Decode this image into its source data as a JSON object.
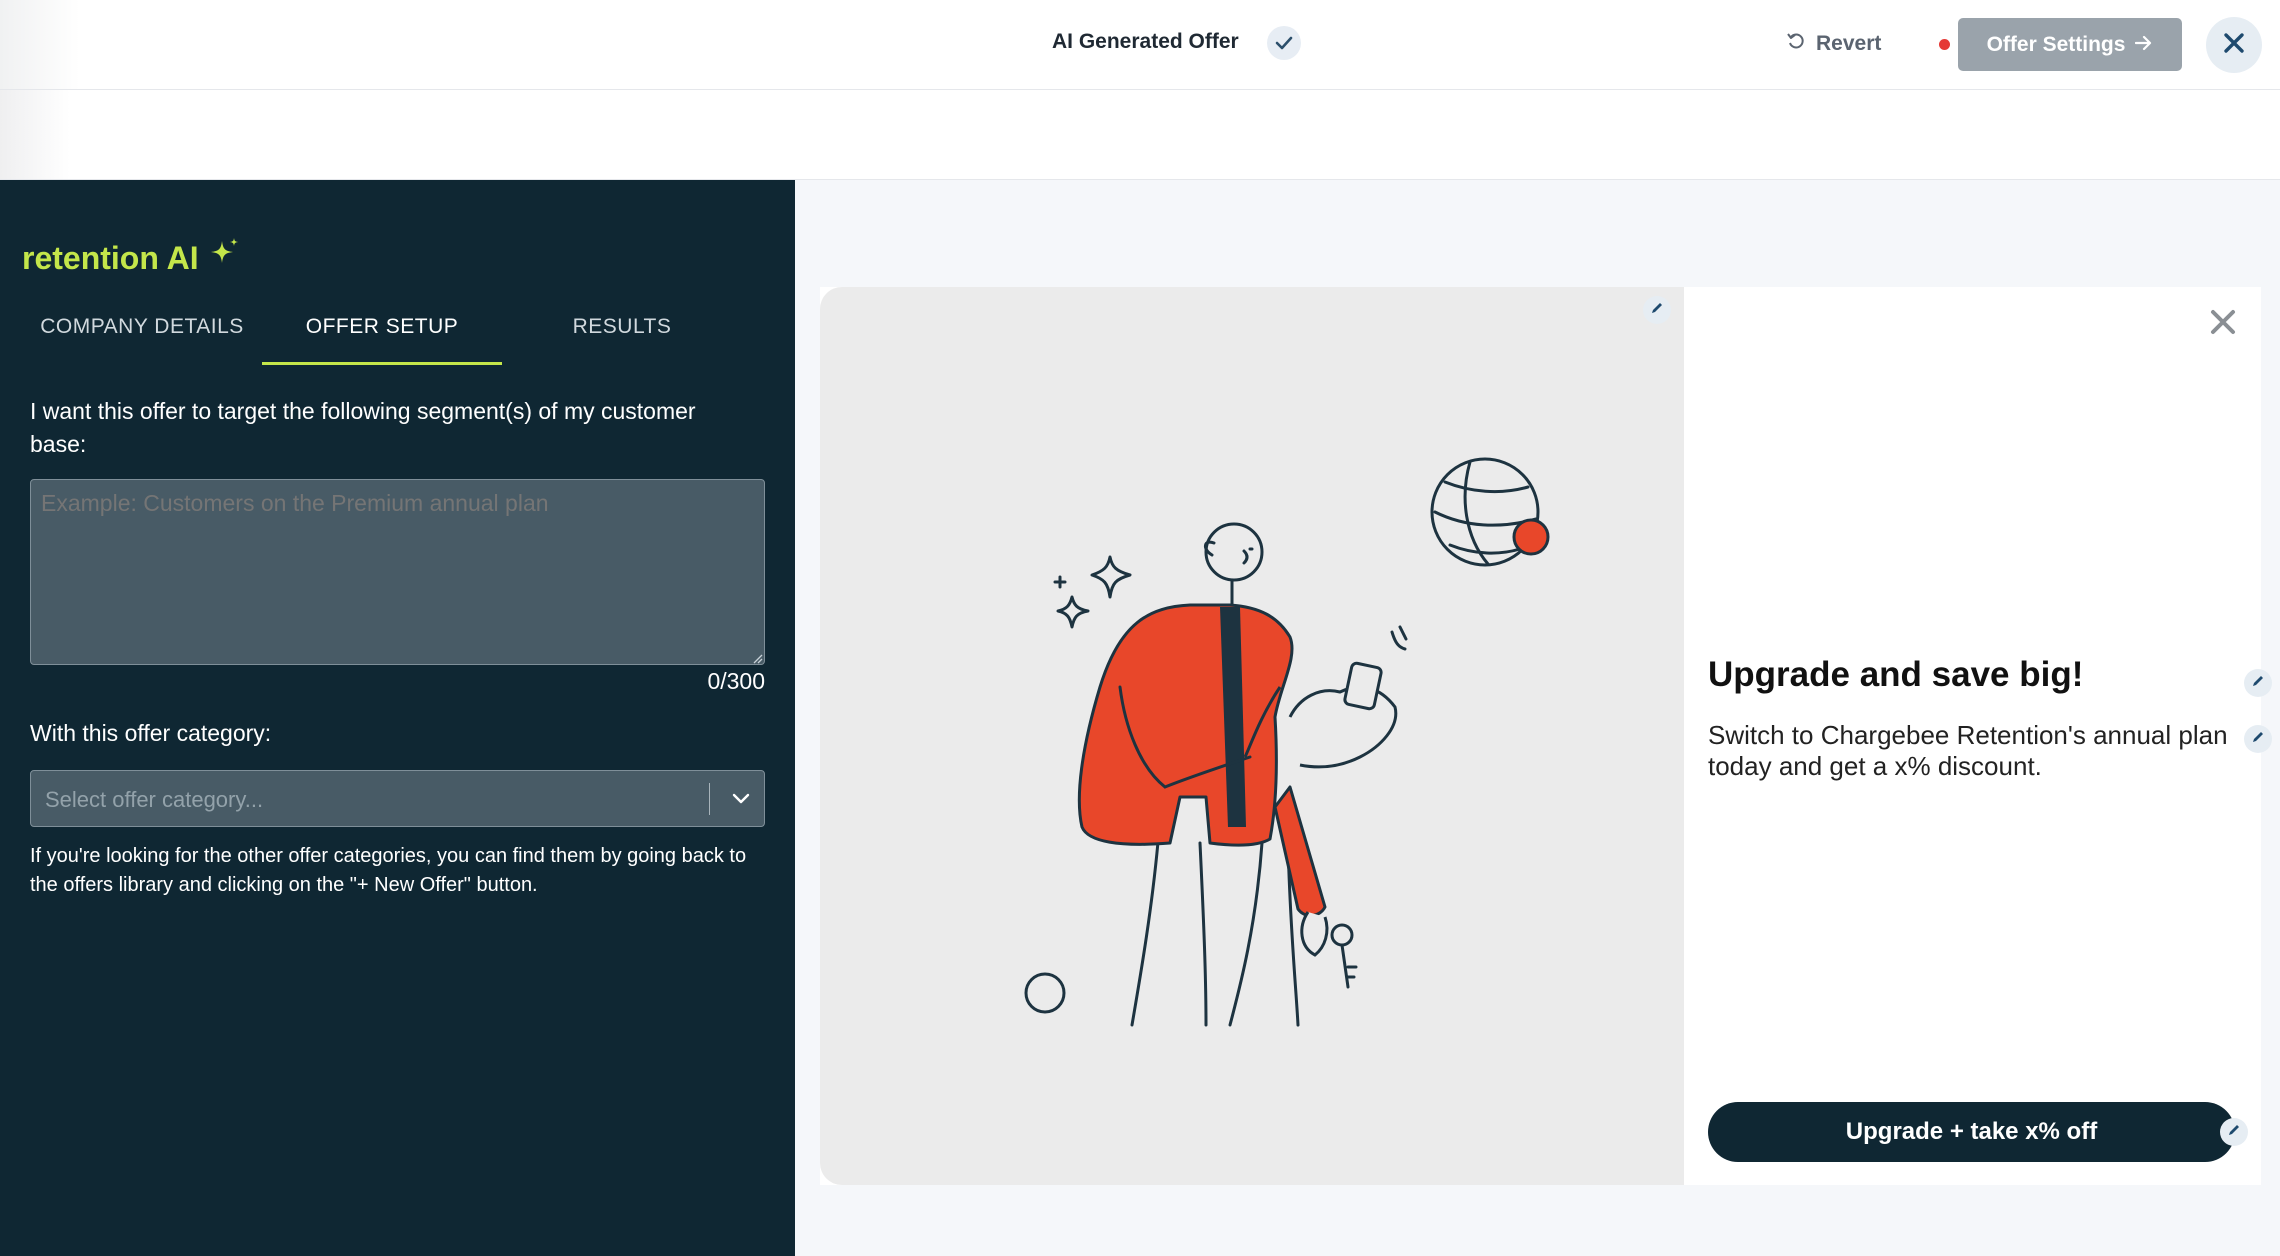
{
  "header": {
    "title": "AI Generated Offer",
    "revert_label": "Revert",
    "offer_settings_label": "Offer Settings"
  },
  "sidebar": {
    "brand": "retention AI",
    "tabs": [
      {
        "label": "COMPANY DETAILS",
        "active": false
      },
      {
        "label": "OFFER SETUP",
        "active": true
      },
      {
        "label": "RESULTS",
        "active": false
      }
    ],
    "segment_question": "I want this offer to target the following segment(s) of my customer base:",
    "segment_placeholder": "Example: Customers on the Premium annual plan",
    "segment_value": "",
    "char_count": "0/300",
    "category_label": "With this offer category:",
    "category_placeholder": "Select offer category...",
    "help_text": "If you're looking for the other offer categories, you can find them by going back to the offers library and clicking on the \"+ New Offer\" button."
  },
  "preview": {
    "headline": "Upgrade and save big!",
    "body": "Switch to Chargebee Retention's annual plan today and get a x% discount.",
    "cta_label": "Upgrade + take x% off"
  },
  "colors": {
    "panel_bg": "#0f2733",
    "brand_accent": "#c4e64a",
    "illustration_accent": "#e8472a",
    "button_disabled": "#9aa3ab",
    "status_dot": "#e53935"
  }
}
